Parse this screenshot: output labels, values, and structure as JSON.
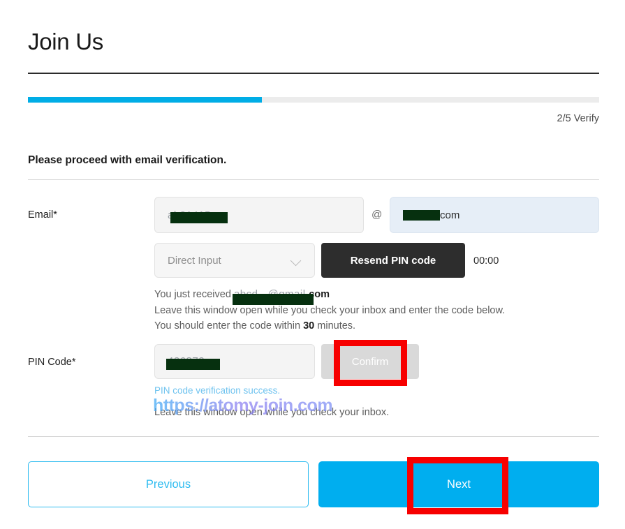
{
  "header": {
    "title": "Join Us"
  },
  "progress": {
    "percent": 41,
    "step_label": "2/5 Verify"
  },
  "intro": {
    "text": "Please proceed with email verification."
  },
  "form": {
    "email": {
      "label": "Email*",
      "local_value_ghost": "ah31415",
      "at_symbol": "@",
      "domain_value_redacted": "",
      "domain_suffix": "com"
    },
    "provider_select": {
      "placeholder": "Direct Input",
      "chevron": "chevron-down-icon"
    },
    "resend_button": {
      "label": "Resend PIN code"
    },
    "timer": {
      "value": "00:00"
    },
    "helper": {
      "line1_prefix": "You just received ",
      "line1_redacted_ghost": "abcd...@gmail.",
      "line1_suffix": "com",
      "line2": "Leave this window open while you check your inbox and enter the code below.",
      "line3_prefix": "You should enter the code within ",
      "line3_bold": "30",
      "line3_suffix": " minutes."
    },
    "pin": {
      "label": "PIN Code*",
      "value_ghost": "426872",
      "confirm_button": "Confirm",
      "success_message": "PIN code verification success.",
      "helper": "Leave this window open while you check your inbox."
    }
  },
  "watermark": {
    "text": "https://atomy-join.com"
  },
  "footer": {
    "previous_label": "Previous",
    "next_label": "Next"
  },
  "colors": {
    "accent": "#00aeef",
    "progress_fill": "#00ade6",
    "progress_track": "#ececec",
    "resend_button_bg": "#2d2d2d",
    "confirm_disabled_bg": "#d9d9d9",
    "success_text": "#6fc3ef",
    "annotation_red": "#f70000",
    "redaction_bar": "#06300f",
    "domain_field_bg": "#e6eef7"
  }
}
